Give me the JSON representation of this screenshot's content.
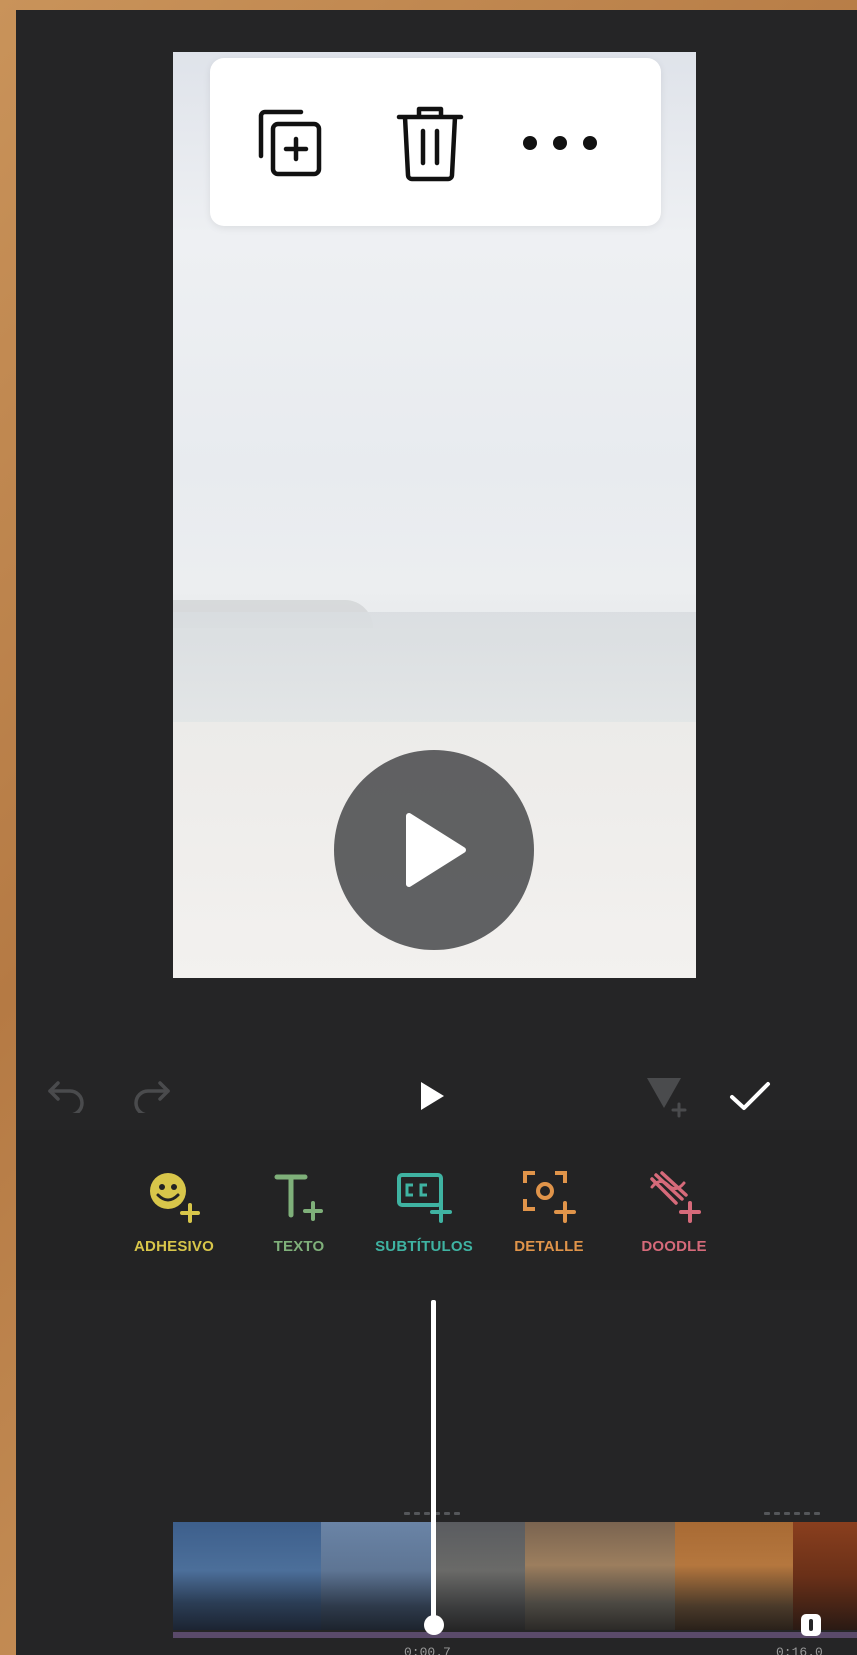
{
  "editor_toolbar": {
    "duplicate": "duplicate-icon",
    "delete": "trash-icon",
    "more": "more-icon"
  },
  "controls": {
    "undo": "undo-icon",
    "redo": "redo-icon",
    "play": "play-icon",
    "add_clip": "add-clip-icon",
    "confirm": "check-icon"
  },
  "tools": [
    {
      "label": "ADHESIVO",
      "icon": "sticker-icon",
      "color": "#d8c64a"
    },
    {
      "label": "TEXTO",
      "icon": "text-icon",
      "color": "#7fb07a"
    },
    {
      "label": "SUBTÍTULOS",
      "icon": "subtitles-icon",
      "color": "#3fb3a2"
    },
    {
      "label": "DETALLE",
      "icon": "detail-icon",
      "color": "#e0944a"
    },
    {
      "label": "DOODLE",
      "icon": "doodle-icon",
      "color": "#d66a7a"
    }
  ],
  "timeline": {
    "start_time": "0:00.7",
    "end_time": "0:16.0"
  },
  "colors": {
    "background": "#252526",
    "accent_white": "#ffffff"
  }
}
